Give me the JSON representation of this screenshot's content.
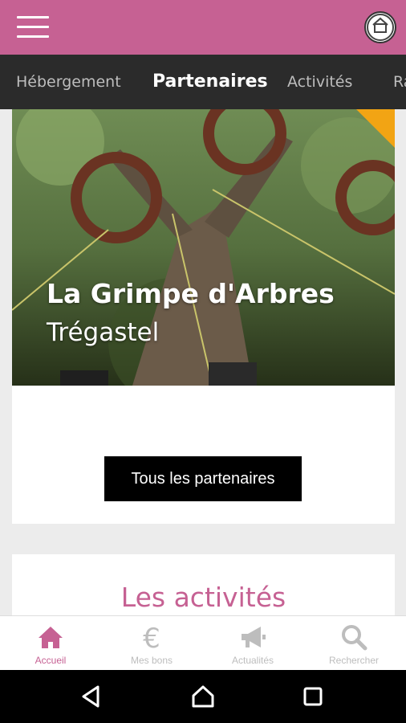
{
  "app": {
    "brand_color": "#c66193"
  },
  "tabs": [
    {
      "label": "Hébergement"
    },
    {
      "label": "Partenaires",
      "active": true
    },
    {
      "label": "Activités"
    },
    {
      "label": "Ra"
    }
  ],
  "hero": {
    "title": "La Grimpe d'Arbres",
    "subtitle": "Trégastel"
  },
  "partners_button": {
    "label": "Tous les partenaires"
  },
  "activities_section": {
    "title": "Les activités"
  },
  "bottom_nav": [
    {
      "label": "Accueil",
      "icon": "home-icon",
      "active": true
    },
    {
      "label": "Mes bons",
      "icon": "euro-icon"
    },
    {
      "label": "Actualités",
      "icon": "megaphone-icon"
    },
    {
      "label": "Rechercher",
      "icon": "search-icon"
    }
  ],
  "system_nav": {
    "icons": [
      "back-icon",
      "home-icon",
      "recents-icon"
    ]
  }
}
